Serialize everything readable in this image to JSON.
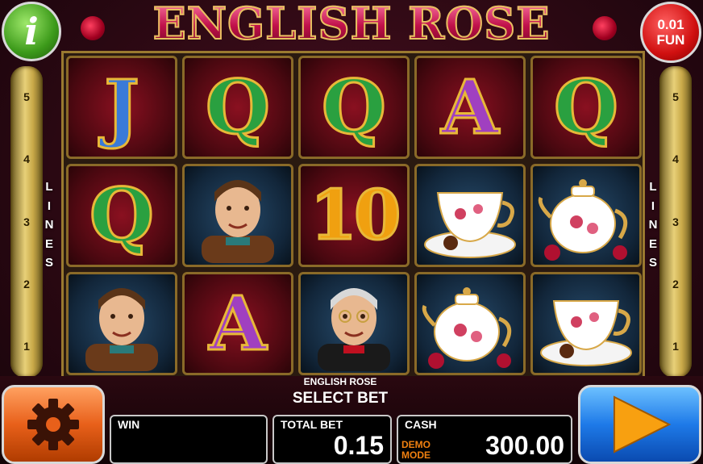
{
  "header": {
    "title": "ENGLISH ROSE",
    "info_icon_glyph": "i",
    "bet_value": "0.01",
    "mode": "FUN"
  },
  "lines": {
    "word": [
      "L",
      "I",
      "N",
      "E",
      "S"
    ],
    "left": [
      "5",
      "4",
      "3",
      "2",
      "1"
    ],
    "right": [
      "5",
      "4",
      "3",
      "2",
      "1"
    ]
  },
  "reels": {
    "columns": [
      [
        "J",
        "Q",
        "man"
      ],
      [
        "Q",
        "man",
        "A"
      ],
      [
        "Q",
        "10",
        "butler"
      ],
      [
        "A",
        "teacup",
        "teapot"
      ],
      [
        "Q",
        "teapot",
        "teacup"
      ]
    ]
  },
  "footer": {
    "game_name": "ENGLISH ROSE",
    "select_bet": "SELECT BET",
    "win_label": "WIN",
    "win_value": "",
    "total_bet_label": "TOTAL BET",
    "total_bet_value": "0.15",
    "cash_label": "CASH",
    "demo_mode": "DEMO MODE",
    "cash_value": "300.00"
  },
  "colors": {
    "info_button": "#3c9a1a",
    "fun_button": "#d01010",
    "settings_button": "#e8601a",
    "play_button": "#1e7ae8",
    "play_arrow": "#f8a010",
    "frame_gold": "#c8a848"
  },
  "icons": {
    "settings": "gear-icon",
    "play": "play-arrow-icon",
    "info": "info-icon"
  }
}
